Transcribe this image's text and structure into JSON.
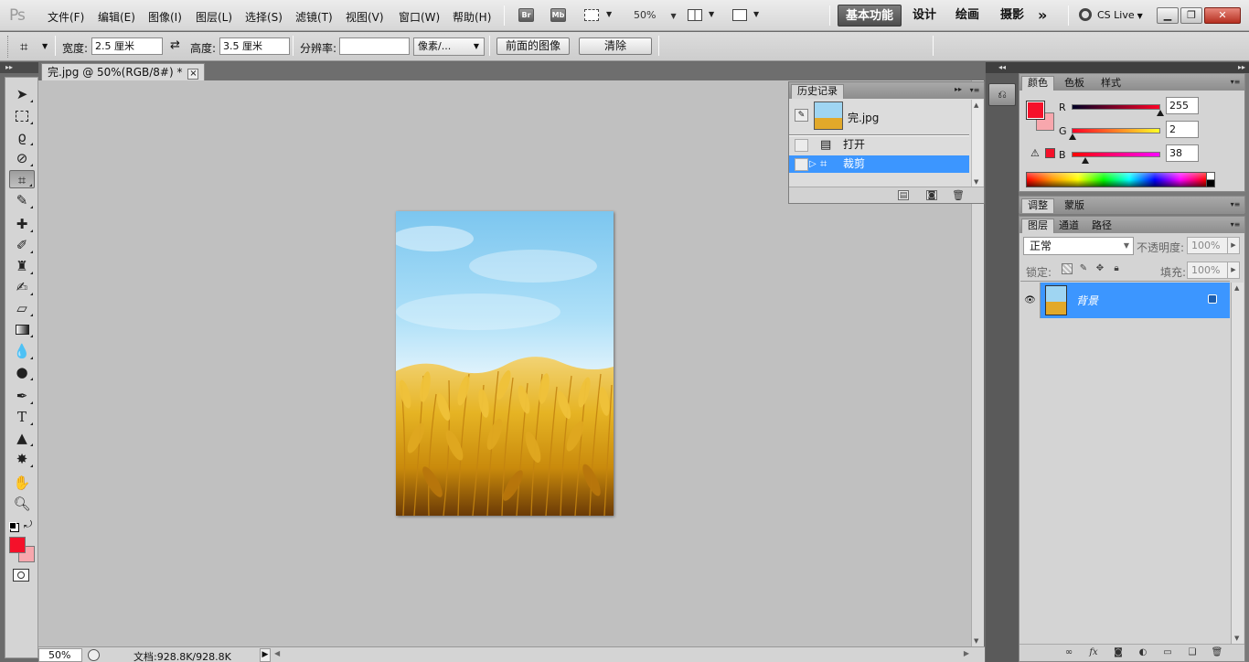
{
  "app": {
    "logo": "Ps",
    "menus": [
      "文件(F)",
      "编辑(E)",
      "图像(I)",
      "图层(L)",
      "选择(S)",
      "滤镜(T)",
      "视图(V)",
      "窗口(W)",
      "帮助(H)"
    ],
    "bridge_label": "Br",
    "mini_bridge_label": "Mb",
    "zoom": "50%",
    "workspaces": [
      "基本功能",
      "设计",
      "绘画",
      "摄影"
    ],
    "workspace_more": "»",
    "cslive": "CS Live"
  },
  "options": {
    "width_label": "宽度:",
    "width_value": "2.5 厘米",
    "swap_icon": "⇄",
    "height_label": "高度:",
    "height_value": "3.5 厘米",
    "resolution_label": "分辨率:",
    "resolution_value": "",
    "unit_value": "像素/...",
    "front_image_button": "前面的图像",
    "clear_button": "清除"
  },
  "document": {
    "tab_title": "完.jpg @ 50%(RGB/8#) *",
    "close_glyph": "×"
  },
  "status": {
    "zoom": "50%",
    "doc_size": "文档:928.8K/928.8K"
  },
  "history": {
    "title": "历史记录",
    "snapshot_name": "完.jpg",
    "rows": [
      {
        "label": "打开",
        "selected": false
      },
      {
        "label": "裁剪",
        "selected": true
      }
    ]
  },
  "color": {
    "tabs": [
      "颜色",
      "色板",
      "样式"
    ],
    "foreground": "#f5112a",
    "background": "#f8a7ad",
    "r_label": "R",
    "g_label": "G",
    "b_label": "B",
    "r": 255,
    "g": 2,
    "b": 38,
    "r_fraction": 1.0,
    "g_fraction": 0.01,
    "b_fraction": 0.15
  },
  "adjust": {
    "tabs": [
      "调整",
      "蒙版"
    ]
  },
  "layers": {
    "tabs": [
      "图层",
      "通道",
      "路径"
    ],
    "blend_mode": "正常",
    "opacity_label": "不透明度:",
    "opacity": "100%",
    "lock_label": "锁定:",
    "fill_label": "填充:",
    "fill": "100%",
    "layer_name": "背景"
  },
  "swatches": {
    "foreground": "#f5112a",
    "background": "#f8a7ad"
  }
}
